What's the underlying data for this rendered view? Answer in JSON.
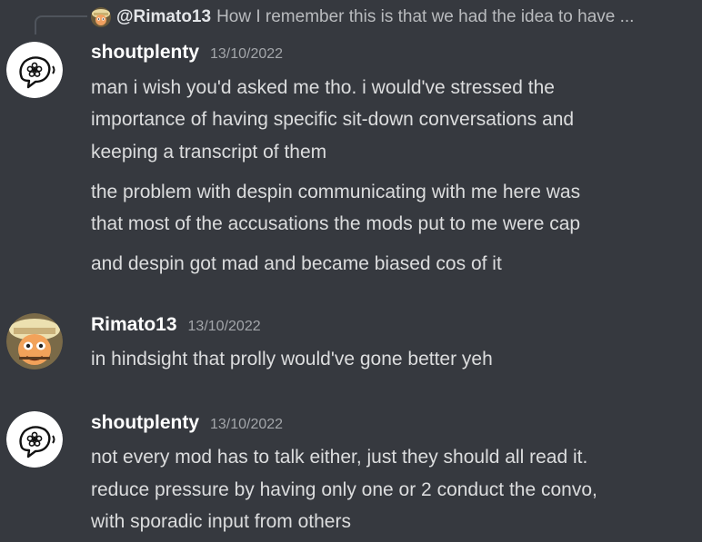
{
  "reply": {
    "author": "@Rimato13",
    "preview": "How I remember this is that we had the idea to have ..."
  },
  "messages": [
    {
      "author": "shoutplenty",
      "timestamp": "13/10/2022",
      "avatar_icon": "shoutplenty-avatar-icon",
      "lines": [
        "man i wish you'd asked me tho. i would've stressed the",
        "importance of having specific sit-down conversations and",
        "keeping a transcript of them",
        "the problem with despin communicating with me here was",
        "that most of the accusations the mods put to me were cap",
        "and despin got mad and became biased cos of it"
      ]
    },
    {
      "author": "Rimato13",
      "timestamp": "13/10/2022",
      "avatar_icon": "rimato13-avatar-icon",
      "lines": [
        "in hindsight that prolly would've gone better yeh"
      ]
    },
    {
      "author": "shoutplenty",
      "timestamp": "13/10/2022",
      "avatar_icon": "shoutplenty-avatar-icon",
      "lines": [
        "not every mod has to talk either, just they should all read it.",
        "reduce pressure by having only one or 2 conduct the convo,",
        "with sporadic input from others"
      ]
    }
  ],
  "colors": {
    "background": "#36393f",
    "username": "#ffffff",
    "message_text": "#dcddde",
    "timestamp": "#a3a6aa",
    "reply_spine": "#4f545c"
  }
}
